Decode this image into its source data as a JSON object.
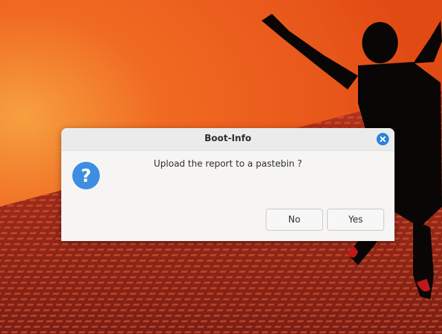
{
  "dialog": {
    "title": "Boot-Info",
    "message": "Upload the report to a pastebin ?",
    "buttons": {
      "no": "No",
      "yes": "Yes"
    },
    "icon": "question-icon",
    "close_icon": "close-icon"
  },
  "colors": {
    "accent": "#2b82d9",
    "question_icon": "#3d8ee0",
    "dialog_bg": "#f6f5f4",
    "titlebar_bg": "#ebebeb"
  }
}
